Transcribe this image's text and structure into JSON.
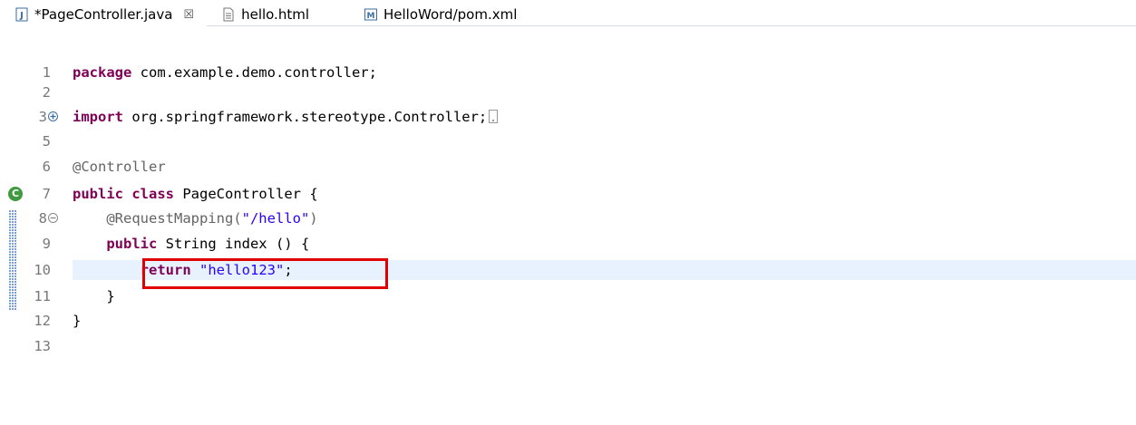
{
  "tabs": [
    {
      "label": "*PageController.java",
      "icon": "java-file-icon",
      "active": true,
      "close": "☒"
    },
    {
      "label": "hello.html",
      "icon": "html-file-icon",
      "active": false
    },
    {
      "label": "HelloWord/pom.xml",
      "icon": "maven-pom-icon",
      "active": false
    }
  ],
  "editor": {
    "lines": [
      {
        "num": "1"
      },
      {
        "num": "2"
      },
      {
        "num": "3"
      },
      {
        "num": "5"
      },
      {
        "num": "6"
      },
      {
        "num": "7"
      },
      {
        "num": "8"
      },
      {
        "num": "9"
      },
      {
        "num": "10"
      },
      {
        "num": "11"
      },
      {
        "num": "12"
      },
      {
        "num": "13"
      }
    ],
    "code": {
      "l1_kw": "package",
      "l1_rest": " com.example.demo.controller;",
      "l3_kw": "import",
      "l3_rest": " org.springframework.stereotype.Controller;",
      "l6_ann": "@Controller",
      "l7_kw1": "public",
      "l7_kw2": "class",
      "l7_rest": " PageController {",
      "l8_indent": "    ",
      "l8_ann": "@RequestMapping(",
      "l8_str": "\"/hello\"",
      "l8_close": ")",
      "l9_indent": "    ",
      "l9_kw": "public",
      "l9_rest": " String index () {",
      "l10_indent": "        ",
      "l10_kw": "return",
      "l10_sp": " ",
      "l10_str": "\"hello123\"",
      "l10_end": ";",
      "l11_text": "    }",
      "l12_text": "}"
    },
    "colors": {
      "keyword": "#7f0055",
      "string": "#2a00ff",
      "annotation": "#646464",
      "highlight": "#e8f2fe",
      "redbox": "#e00000"
    }
  }
}
